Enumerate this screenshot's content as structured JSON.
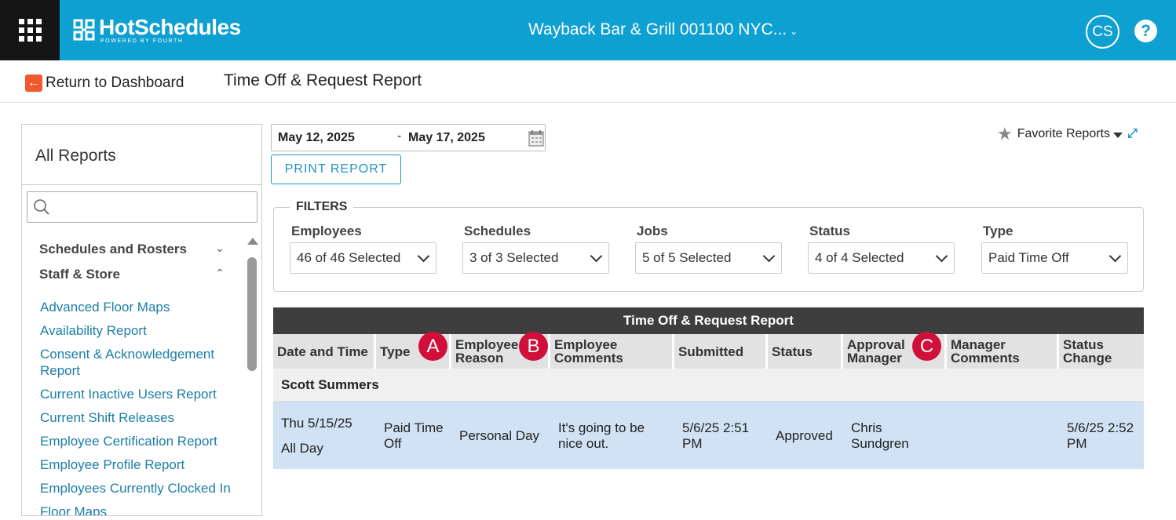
{
  "app": {
    "brand": "HotSchedules",
    "brand_tagline": "POWERED BY FOURTH",
    "location": "Wayback Bar & Grill 001100 NYC...",
    "user_initials": "CS",
    "help_label": "?"
  },
  "subbar": {
    "return_label": "Return to Dashboard",
    "report_title": "Time Off & Request Report"
  },
  "sidebar": {
    "title": "All Reports",
    "search_placeholder": "",
    "categories": [
      {
        "label": "Schedules and Rosters",
        "expanded": false
      },
      {
        "label": "Staff & Store",
        "expanded": true
      }
    ],
    "links": [
      "Advanced Floor Maps",
      "Availability Report",
      "Consent & Acknowledgement Report",
      "Current Inactive Users Report",
      "Current Shift Releases",
      "Employee Certification Report",
      "Employee Profile Report",
      "Employees Currently Clocked In",
      "Floor Maps"
    ]
  },
  "controls": {
    "date_start": "May 12, 2025",
    "date_sep": "-",
    "date_end": "May 17, 2025",
    "print_label": "PRINT REPORT",
    "favorite_label": "Favorite Reports"
  },
  "filters": {
    "legend": "FILTERS",
    "items": [
      {
        "label": "Employees",
        "value": "46 of 46 Selected"
      },
      {
        "label": "Schedules",
        "value": "3 of 3 Selected"
      },
      {
        "label": "Jobs",
        "value": "5 of 5 Selected"
      },
      {
        "label": "Status",
        "value": "4 of 4 Selected"
      },
      {
        "label": "Type",
        "value": "Paid Time Off"
      }
    ]
  },
  "table": {
    "title": "Time Off & Request Report",
    "columns": [
      {
        "line1": "Date and Time",
        "line2": ""
      },
      {
        "line1": "Type",
        "line2": ""
      },
      {
        "line1": "Employee",
        "line2": "Reason"
      },
      {
        "line1": "Employee",
        "line2": "Comments"
      },
      {
        "line1": "Submitted",
        "line2": ""
      },
      {
        "line1": "Status",
        "line2": ""
      },
      {
        "line1": "Approval",
        "line2": "Manager"
      },
      {
        "line1": "Manager",
        "line2": "Comments"
      },
      {
        "line1": "Status",
        "line2": "Change"
      }
    ],
    "group": "Scott Summers",
    "row": {
      "date": "Thu 5/15/25",
      "duration": "All Day",
      "type": "Paid Time Off",
      "reason": "Personal Day",
      "comments": "It's going to be nice out.",
      "submitted": "5/6/25 2:51 PM",
      "status": "Approved",
      "approval_manager": "Chris Sundgren",
      "manager_comments": "",
      "status_change": "5/6/25 2:52 PM"
    }
  },
  "annotations": {
    "a": "A",
    "b": "B",
    "c": "C"
  },
  "colors": {
    "topbar": "#0fa0d2",
    "accent": "#1f95c4",
    "badge": "#d0103a",
    "row_highlight": "#d0e2f4",
    "table_header": "#3e3e3e"
  }
}
